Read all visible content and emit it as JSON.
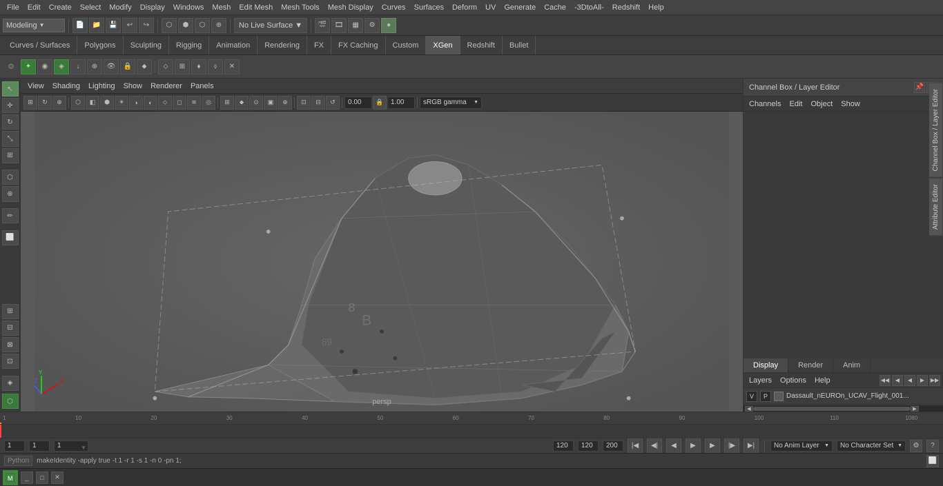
{
  "menubar": {
    "items": [
      "File",
      "Edit",
      "Create",
      "Select",
      "Modify",
      "Display",
      "Windows",
      "Mesh",
      "Edit Mesh",
      "Mesh Tools",
      "Mesh Display",
      "Curves",
      "Surfaces",
      "Deform",
      "UV",
      "Generate",
      "Cache",
      "-3DtoAll-",
      "Redshift",
      "Help"
    ]
  },
  "toolbar": {
    "mode": "Modeling",
    "mode_arrow": "▼",
    "live_surface": "No Live Surface"
  },
  "tabs": {
    "items": [
      "Curves / Surfaces",
      "Polygons",
      "Sculpting",
      "Rigging",
      "Animation",
      "Rendering",
      "FX",
      "FX Caching",
      "Custom",
      "XGen",
      "Redshift",
      "Bullet"
    ],
    "active": "XGen"
  },
  "viewport_menu": {
    "items": [
      "View",
      "Shading",
      "Lighting",
      "Show",
      "Renderer",
      "Panels"
    ]
  },
  "viewport_tools": {
    "coord_value": "0.00",
    "size_value": "1.00",
    "gamma_label": "sRGB gamma",
    "gamma_arrow": "▼"
  },
  "viewport": {
    "camera_label": "persp"
  },
  "channel_box": {
    "title": "Channel Box / Layer Editor",
    "menu_items": [
      "Channels",
      "Edit",
      "Object",
      "Show"
    ]
  },
  "lower_tabs": {
    "items": [
      "Display",
      "Render",
      "Anim"
    ],
    "active": "Display"
  },
  "layers": {
    "title": "Layers",
    "menu_items": [
      "Layers",
      "Options",
      "Help"
    ],
    "nav_arrows": [
      "◀◀",
      "◀",
      "◀",
      "▶",
      "▶▶",
      "▶▶"
    ],
    "layer_row": {
      "v": "V",
      "p": "P",
      "name": "Dassault_nEUROn_UCAV_Flight_001..."
    }
  },
  "timeline": {
    "start": "1",
    "end": "120",
    "current_frame": "1",
    "playback_end": "120",
    "total_frames": "200"
  },
  "status_bar": {
    "left_val1": "1",
    "left_val2": "1",
    "frame_indicator": "1",
    "anim_end": "120",
    "playback_end_val": "120",
    "total_val": "200",
    "anim_layer": "No Anim Layer",
    "char_set": "No Character Set"
  },
  "python": {
    "label": "Python",
    "command": "makeIdentity -apply true -t 1 -r 1 -s 1 -n 0 -pn 1;"
  },
  "window_bar": {
    "icon1": "⬜",
    "icon2": "⬜",
    "icon3": "✕"
  },
  "right_edge": {
    "tab1": "Channel Box / Layer Editor",
    "tab2": "Attribute Editor"
  },
  "aircraft": {
    "color": "#6a6a6a"
  },
  "icons": {
    "gear": "⚙",
    "arrow_left": "◄",
    "arrow_right": "►",
    "play": "▶",
    "play_end": "▶|",
    "rewind": "|◀",
    "next_frame": "▶",
    "loop": "↺",
    "x_axis": "X",
    "y_axis": "Y",
    "z_axis": "Z"
  }
}
